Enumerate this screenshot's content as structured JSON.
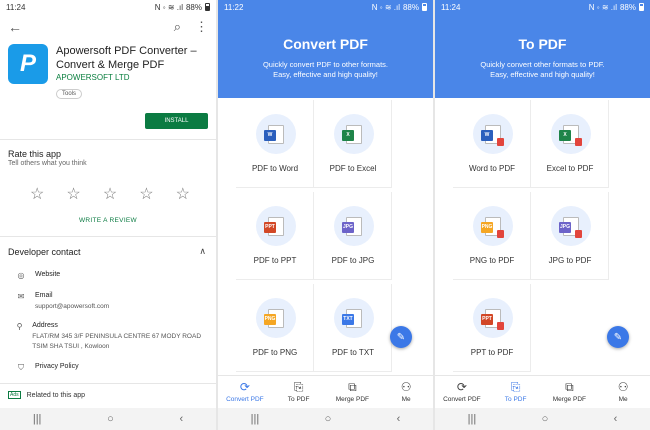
{
  "status": {
    "left_time": "11:24",
    "mid_time": "11:22",
    "right_time": "11:24",
    "battery": "88%",
    "net_icons": "N ◦ ≋ .ıl"
  },
  "playstore": {
    "back_glyph": "←",
    "search_glyph": "⌕",
    "more_glyph": "⋮",
    "app_icon_letter": "P",
    "app_title_line1": "Apowersoft PDF Converter –",
    "app_title_line2": "Convert & Merge PDF",
    "developer": "APOWERSOFT LTD",
    "chip": "Tools",
    "install": "INSTALL",
    "rate_title": "Rate this app",
    "rate_sub": "Tell others what you think",
    "star_glyph": "☆",
    "write_review": "WRITE A REVIEW",
    "dev_contact": "Developer contact",
    "caret": "∧",
    "contacts": [
      {
        "icon": "◎",
        "label": "Website",
        "value": ""
      },
      {
        "icon": "✉",
        "label": "Email",
        "value": "support@apowersoft.com"
      },
      {
        "icon": "⚲",
        "label": "Address",
        "value": "FLAT/RM 345 3/F PENINSULA CENTRE 67 MODY ROAD TSIM SHA TSUI , Kowloon"
      },
      {
        "icon": "⛉",
        "label": "Privacy Policy",
        "value": ""
      }
    ],
    "ads": "Ads",
    "related": "Related to this app"
  },
  "navbar": {
    "recents": "|||",
    "home": "○",
    "back": "‹"
  },
  "convert": {
    "title": "Convert PDF",
    "sub_line1": "Quickly convert PDF to other formats.",
    "sub_line2": "Easy, effective and high quality!",
    "items": [
      {
        "label": "PDF to Word",
        "tag": "W",
        "color": "#2b5fbd"
      },
      {
        "label": "PDF to Excel",
        "tag": "X",
        "color": "#1e8449"
      },
      {
        "label": "PDF to PPT",
        "tag": "PPT",
        "color": "#d24726"
      },
      {
        "label": "PDF to JPG",
        "tag": "JPG",
        "color": "#6c63c9"
      },
      {
        "label": "PDF to PNG",
        "tag": "PNG",
        "color": "#f5a623"
      },
      {
        "label": "PDF to TXT",
        "tag": "TXT",
        "color": "#3b78e7"
      }
    ]
  },
  "topdf": {
    "title": "To PDF",
    "sub_line1": "Quickly convert other formats to PDF.",
    "sub_line2": "Easy, effective and high quality!",
    "items": [
      {
        "label": "Word to PDF",
        "tag": "W",
        "color": "#2b5fbd"
      },
      {
        "label": "Excel to PDF",
        "tag": "X",
        "color": "#1e8449"
      },
      {
        "label": "PNG to PDF",
        "tag": "PNG",
        "color": "#f5a623"
      },
      {
        "label": "JPG to PDF",
        "tag": "JPG",
        "color": "#6c63c9"
      },
      {
        "label": "PPT to PDF",
        "tag": "PPT",
        "color": "#d24726"
      }
    ]
  },
  "tabs": [
    {
      "label": "Convert PDF",
      "icon": "⟳"
    },
    {
      "label": "To PDF",
      "icon": "⎘"
    },
    {
      "label": "Merge PDF",
      "icon": "⧉"
    },
    {
      "label": "Me",
      "icon": "⚇"
    }
  ],
  "fab_glyph": "✎",
  "accent": "#4a86e8"
}
